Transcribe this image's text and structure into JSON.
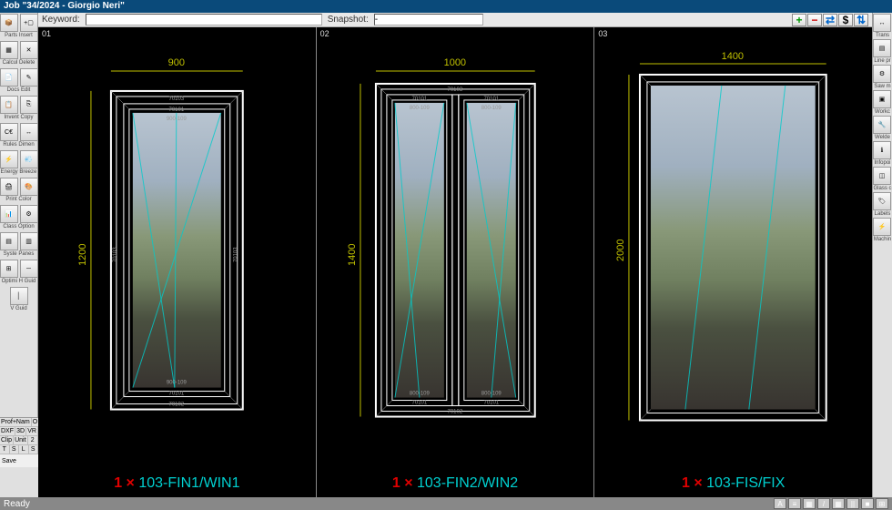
{
  "title": "Job \"34/2024 - Giorgio Neri\"",
  "keyword_label": "Keyword:",
  "keyword_value": "",
  "snapshot_label": "Snapshot:",
  "snapshot_value": "-",
  "action_buttons": [
    "+",
    "−",
    "⇄",
    "$",
    "⇅"
  ],
  "left_tools": [
    {
      "pair": [
        "Parts",
        "Insert"
      ]
    },
    {
      "pair": [
        "Calcul",
        "Delete"
      ]
    },
    {
      "pair": [
        "Docs",
        "Edit"
      ]
    },
    {
      "pair": [
        "Invent",
        "Copy"
      ]
    },
    {
      "pair": [
        "Rules",
        "Dimen"
      ]
    },
    {
      "pair": [
        "Energy",
        "Breeze"
      ]
    },
    {
      "pair": [
        "Print",
        "Color"
      ]
    },
    {
      "pair": [
        "Class",
        "Option"
      ]
    },
    {
      "pair": [
        "Syste",
        "Panes"
      ]
    },
    {
      "pair": [
        "Optimi",
        "H Guid"
      ]
    },
    {
      "pair": [
        "V Guid",
        ""
      ]
    }
  ],
  "right_tools": [
    "Trans",
    "Line pr",
    "Saw m",
    "Workc",
    "Welde",
    "Infopoi",
    "Glass c",
    "Labels",
    "Machin"
  ],
  "left_panel_rows": [
    {
      "cells": [
        "Prof+Nam",
        "O"
      ]
    },
    {
      "cells": [
        "DXF",
        "3D",
        "VR"
      ]
    },
    {
      "cells": [
        "Clip",
        "Unit",
        "2"
      ]
    },
    {
      "cells": [
        "T",
        "S",
        "L",
        "S"
      ]
    }
  ],
  "save_label": "Save",
  "status": "Ready",
  "status_tools": [
    "A",
    "≡",
    "▦",
    "/",
    "▦",
    "||",
    "■",
    "⊞"
  ],
  "windows": [
    {
      "num": "01",
      "width_dim": "900",
      "height_dim": "1200",
      "qty": "1 ×",
      "code": "103-FIN1/WIN1",
      "profiles": {
        "top_outer": "70103",
        "top_mid": "70101",
        "top_inner": "900-109",
        "bot_inner": "900-109",
        "bot_mid": "70101",
        "bot_outer": "70102",
        "side": "70103"
      }
    },
    {
      "num": "02",
      "width_dim": "1000",
      "height_dim": "1400",
      "qty": "1 ×",
      "code": "103-FIN2/WIN2",
      "profiles": {
        "top_outer": "70103",
        "top_l": "70101",
        "top_r": "70101",
        "mid_l": "800-109",
        "mid_r": "800-109",
        "bot_l": "70101",
        "bot_r": "70101",
        "bot_outer": "70102"
      }
    },
    {
      "num": "03",
      "width_dim": "1400",
      "height_dim": "2000",
      "qty": "1 ×",
      "code": "103-FIS/FIX"
    }
  ]
}
